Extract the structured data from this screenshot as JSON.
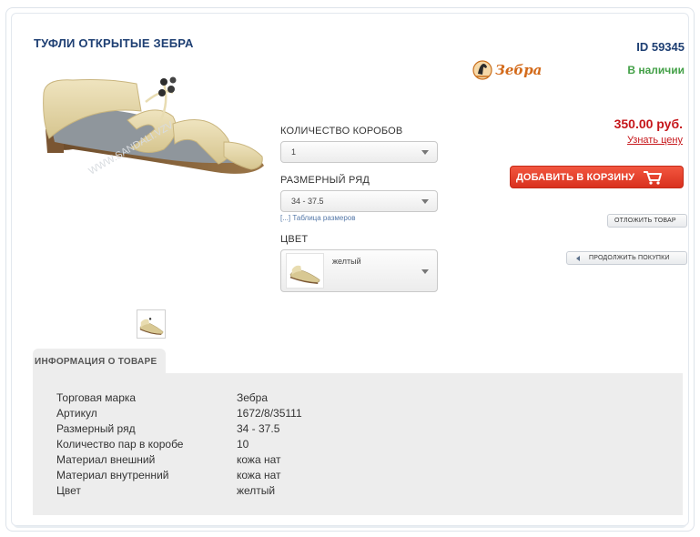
{
  "product": {
    "title": "ТУФЛИ ОТКРЫТЫЕ ЗЕБРА",
    "id": "ID 59345",
    "brand_logo_text": "Зебра",
    "availability": "В наличии",
    "price": "350.00 руб.",
    "know_price_link": "Узнать цену"
  },
  "options": {
    "boxes_label": "КОЛИЧЕСТВО КОРОБОВ",
    "boxes_value": "1",
    "size_label": "РАЗМЕРНЫЙ РЯД",
    "size_value": "34 - 37.5",
    "size_table_link": "[...] Таблица размеров",
    "color_label": "ЦВЕТ",
    "color_value": "желтый"
  },
  "actions": {
    "add_to_cart": "ДОБАВИТЬ В КОРЗИНУ",
    "postpone": "ОТЛОЖИТЬ ТОВАР",
    "continue_shopping": "ПРОДОЛЖИТЬ ПОКУПКИ"
  },
  "info": {
    "tab_label": "ИНФОРМАЦИЯ О ТОВАРЕ",
    "rows": [
      {
        "label": "Торговая марка",
        "value": "Зебра"
      },
      {
        "label": "Артикул",
        "value": "1672/8/35111"
      },
      {
        "label": "Размерный ряд",
        "value": "34 - 37.5"
      },
      {
        "label": "Количество пар в коробе",
        "value": "10"
      },
      {
        "label": "Материал внешний",
        "value": "кожа нат"
      },
      {
        "label": "Материал внутренний",
        "value": "кожа нат"
      },
      {
        "label": "Цвет",
        "value": "желтый"
      }
    ]
  },
  "colors": {
    "title": "#1e3f73",
    "price": "#c6171b",
    "stock": "#43a047",
    "cart_button": "#e2402b"
  }
}
